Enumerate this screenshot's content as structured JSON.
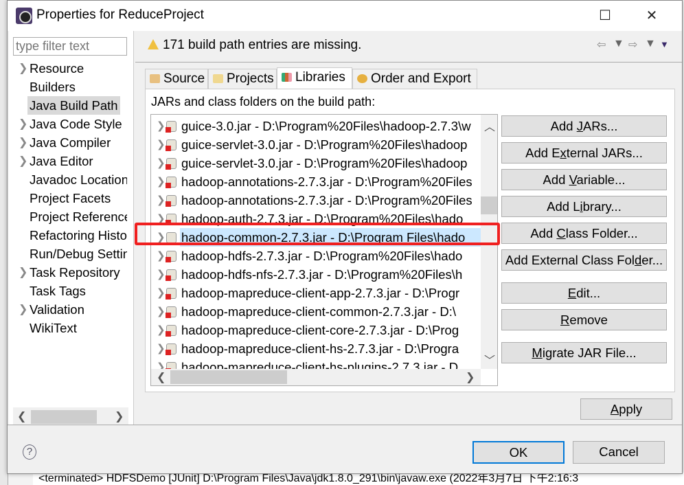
{
  "window": {
    "title": "Properties for ReduceProject",
    "minimize": "—",
    "maximize": "☐",
    "close": "✕"
  },
  "background": {
    "console_text": "<terminated> HDFSDemo [JUnit] D:\\Program Files\\Java\\jdk1.8.0_291\\bin\\javaw.exe (2022年3月7日 下午2:16:3"
  },
  "sidebar": {
    "filter_placeholder": "type filter text",
    "items": [
      {
        "label": "Resource",
        "expandable": true
      },
      {
        "label": "Builders",
        "expandable": false
      },
      {
        "label": "Java Build Path",
        "expandable": false,
        "selected": true
      },
      {
        "label": "Java Code Style",
        "expandable": true
      },
      {
        "label": "Java Compiler",
        "expandable": true
      },
      {
        "label": "Java Editor",
        "expandable": true
      },
      {
        "label": "Javadoc Location",
        "expandable": false
      },
      {
        "label": "Project Facets",
        "expandable": false
      },
      {
        "label": "Project References",
        "expandable": false
      },
      {
        "label": "Refactoring History",
        "expandable": false
      },
      {
        "label": "Run/Debug Settings",
        "expandable": false
      },
      {
        "label": "Task Repository",
        "expandable": true
      },
      {
        "label": "Task Tags",
        "expandable": false
      },
      {
        "label": "Validation",
        "expandable": true
      },
      {
        "label": "WikiText",
        "expandable": false
      }
    ]
  },
  "header": {
    "warning": "171 build path entries are missing."
  },
  "tabs": [
    {
      "label": "Source",
      "icon": "source-folder-icon"
    },
    {
      "label": "Projects",
      "icon": "folder-icon"
    },
    {
      "label": "Libraries",
      "icon": "library-icon",
      "active": true
    },
    {
      "label": "Order and Export",
      "icon": "order-icon"
    }
  ],
  "libraries": {
    "label": "JARs and class folders on the build path:",
    "entries": [
      {
        "text": "guice-3.0.jar - D:\\Program%20Files\\hadoop-2.7.3\\w",
        "missing": true
      },
      {
        "text": "guice-servlet-3.0.jar - D:\\Program%20Files\\hadoop",
        "missing": true
      },
      {
        "text": "guice-servlet-3.0.jar - D:\\Program%20Files\\hadoop",
        "missing": true
      },
      {
        "text": "hadoop-annotations-2.7.3.jar - D:\\Program%20Files",
        "missing": true
      },
      {
        "text": "hadoop-annotations-2.7.3.jar - D:\\Program%20Files",
        "missing": true
      },
      {
        "text": "hadoop-auth-2.7.3.jar - D:\\Program%20Files\\hado",
        "missing": true
      },
      {
        "text": "hadoop-common-2.7.3.jar - D:\\Program Files\\hado",
        "missing": false,
        "selected": true
      },
      {
        "text": "hadoop-hdfs-2.7.3.jar - D:\\Program%20Files\\hado",
        "missing": true
      },
      {
        "text": "hadoop-hdfs-nfs-2.7.3.jar - D:\\Program%20Files\\h",
        "missing": true
      },
      {
        "text": "hadoop-mapreduce-client-app-2.7.3.jar - D:\\Progr",
        "missing": true
      },
      {
        "text": "hadoop-mapreduce-client-common-2.7.3.jar - D:\\",
        "missing": true
      },
      {
        "text": "hadoop-mapreduce-client-core-2.7.3.jar - D:\\Prog",
        "missing": true
      },
      {
        "text": "hadoop-mapreduce-client-hs-2.7.3.jar - D:\\Progra",
        "missing": true
      },
      {
        "text": "hadoop-mapreduce-client-hs-plugins-2.7.3.jar - D",
        "missing": true
      }
    ],
    "buttons": {
      "add_jars": [
        "Add ",
        "J",
        "ARs..."
      ],
      "add_external_jars": [
        "Add E",
        "x",
        "ternal JARs..."
      ],
      "add_variable": [
        "Add ",
        "V",
        "ariable..."
      ],
      "add_library": [
        "Add L",
        "i",
        "brary..."
      ],
      "add_class_folder": [
        "Add ",
        "C",
        "lass Folder..."
      ],
      "add_external_class_folder": [
        "Add External Class Fol",
        "d",
        "er..."
      ],
      "edit": [
        "",
        "E",
        "dit..."
      ],
      "remove": [
        "",
        "R",
        "emove"
      ],
      "migrate": [
        "",
        "M",
        "igrate JAR File..."
      ]
    }
  },
  "footer": {
    "apply": [
      "",
      "A",
      "pply"
    ],
    "ok": "OK",
    "cancel": "Cancel",
    "help": "?"
  },
  "colors": {
    "highlight_box": "#f02020",
    "selection": "#cce8ff",
    "default_button_border": "#0078d7"
  }
}
